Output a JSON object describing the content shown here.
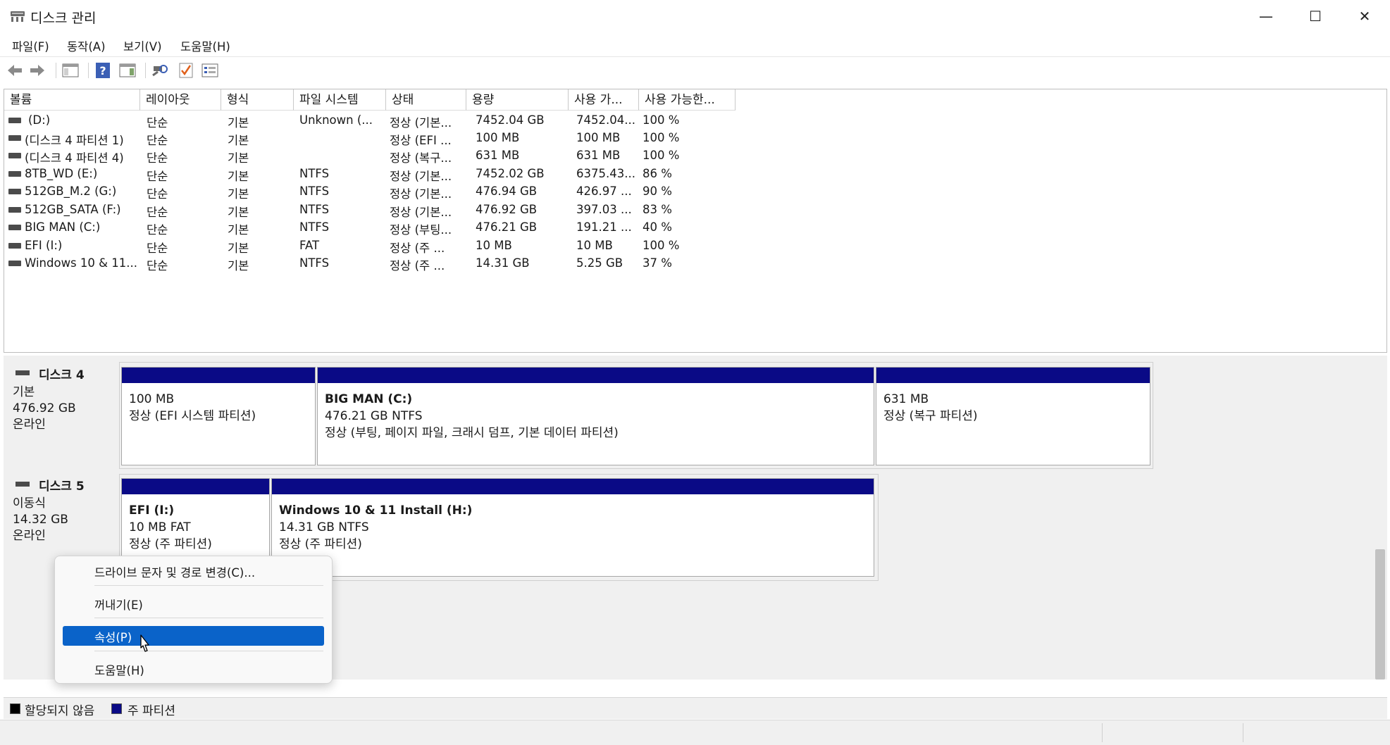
{
  "window": {
    "title": "디스크 관리",
    "icon": "disk-management-icon",
    "controls": {
      "minimize": "—",
      "maximize": "☐",
      "close": "✕"
    }
  },
  "menu": [
    "파일(F)",
    "동작(A)",
    "보기(V)",
    "도움말(H)"
  ],
  "toolbar": {
    "icons": [
      "back-arrow-icon",
      "forward-arrow-icon",
      "console-tree-icon",
      "help-icon",
      "action-pane-icon",
      "rescan-disks-icon",
      "properties-icon",
      "settings-icon"
    ]
  },
  "table": {
    "headers": [
      "볼륨",
      "레이아웃",
      "형식",
      "파일 시스템",
      "상태",
      "용량",
      "사용 가...",
      "사용 가능한..."
    ],
    "rows": [
      [
        "(D:)",
        "단순",
        "기본",
        "Unknown (...",
        "정상 (기본...",
        "7452.04 GB",
        "7452.04...",
        "100 %"
      ],
      [
        "(디스크 4 파티션 1)",
        "단순",
        "기본",
        "",
        "정상 (EFI ...",
        "100 MB",
        "100 MB",
        "100 %"
      ],
      [
        "(디스크 4 파티션 4)",
        "단순",
        "기본",
        "",
        "정상 (복구...",
        "631 MB",
        "631 MB",
        "100 %"
      ],
      [
        "8TB_WD (E:)",
        "단순",
        "기본",
        "NTFS",
        "정상 (기본...",
        "7452.02 GB",
        "6375.43...",
        "86 %"
      ],
      [
        "512GB_M.2 (G:)",
        "단순",
        "기본",
        "NTFS",
        "정상 (기본...",
        "476.94 GB",
        "426.97 ...",
        "90 %"
      ],
      [
        "512GB_SATA (F:)",
        "단순",
        "기본",
        "NTFS",
        "정상 (기본...",
        "476.92 GB",
        "397.03 ...",
        "83 %"
      ],
      [
        "BIG MAN (C:)",
        "단순",
        "기본",
        "NTFS",
        "정상 (부팅...",
        "476.21 GB",
        "191.21 ...",
        "40 %"
      ],
      [
        "EFI (I:)",
        "단순",
        "기본",
        "FAT",
        "정상 (주 ...",
        "10 MB",
        "10 MB",
        "100 %"
      ],
      [
        "Windows 10 & 11...",
        "단순",
        "기본",
        "NTFS",
        "정상 (주 ...",
        "14.31 GB",
        "5.25 GB",
        "37 %"
      ]
    ]
  },
  "disks": [
    {
      "name": "디스크 4",
      "type": "기본",
      "size": "476.92 GB",
      "state": "온라인",
      "partitions": [
        {
          "title": "",
          "line1": "100 MB",
          "line2": "정상 (EFI 시스템 파티션)"
        },
        {
          "title": "BIG MAN  (C:)",
          "line1": "476.21 GB NTFS",
          "line2": "정상 (부팅, 페이지 파일, 크래시 덤프, 기본 데이터 파티션)"
        },
        {
          "title": "",
          "line1": "631 MB",
          "line2": "정상 (복구 파티션)"
        }
      ]
    },
    {
      "name": "디스크 5",
      "type": "이동식",
      "size": "14.32 GB",
      "state": "온라인",
      "partitions": [
        {
          "title": "EFI  (I:)",
          "line1": "10 MB FAT",
          "line2": "정상 (주 파티션)"
        },
        {
          "title": "Windows 10 & 11 Install  (H:)",
          "line1": "14.31 GB NTFS",
          "line2": "정상 (주 파티션)"
        }
      ]
    }
  ],
  "context_menu": {
    "items": [
      "드라이브 문자 및 경로 변경(C)...",
      "꺼내기(E)",
      "속성(P)",
      "도움말(H)"
    ],
    "highlighted": "속성(P)"
  },
  "legend": [
    {
      "label": "할당되지 않음",
      "color": "#000000"
    },
    {
      "label": "주 파티션",
      "color": "#0a0a86"
    }
  ]
}
